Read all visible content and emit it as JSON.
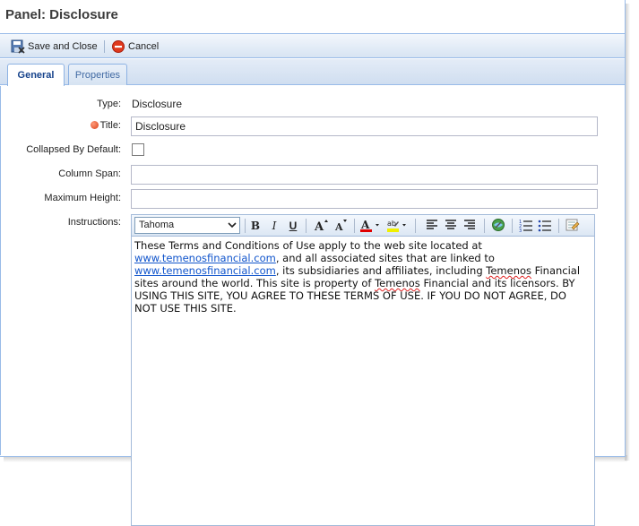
{
  "window": {
    "title": "Panel: Disclosure"
  },
  "toolbar": {
    "save_label": "Save and Close",
    "cancel_label": "Cancel"
  },
  "tabs": [
    {
      "label": "General",
      "active": true
    },
    {
      "label": "Properties",
      "active": false
    }
  ],
  "form": {
    "type_label": "Type:",
    "type_value": "Disclosure",
    "title_label": "Title:",
    "title_value": "Disclosure",
    "collapsed_label": "Collapsed By Default:",
    "collapsed_checked": false,
    "column_span_label": "Column Span:",
    "column_span_value": "",
    "max_height_label": "Maximum Height:",
    "max_height_value": "",
    "instructions_label": "Instructions:"
  },
  "editor": {
    "font_name": "Tahoma",
    "text": {
      "p1": "These Terms and Conditions of Use apply to the web site located at ",
      "link1": "www.temenosfinancial.com",
      "p2": ", and all associated sites that are linked to ",
      "link2": "www.temenosfinancial.com",
      "p3": ", its subsidiaries and affiliates, including ",
      "w1": "Temenos",
      "p4": " Financial sites around the world. This site is property of ",
      "w2": "Temenos",
      "p5": " Financial and its licensors. BY USING THIS SITE, YOU AGREE TO THESE TERMS OF USE. IF YOU DO NOT AGREE, DO NOT USE THIS SITE."
    }
  },
  "colors": {
    "accent": "#15428b",
    "border": "#99bbe8",
    "link": "#1155cc",
    "required": "#d9401a"
  },
  "icons": [
    "save-close-icon",
    "cancel-icon",
    "bold-icon",
    "italic-icon",
    "underline-icon",
    "grow-font-icon",
    "shrink-font-icon",
    "font-color-icon",
    "highlight-icon",
    "align-left-icon",
    "align-center-icon",
    "align-right-icon",
    "link-icon",
    "ordered-list-icon",
    "unordered-list-icon",
    "source-edit-icon"
  ]
}
